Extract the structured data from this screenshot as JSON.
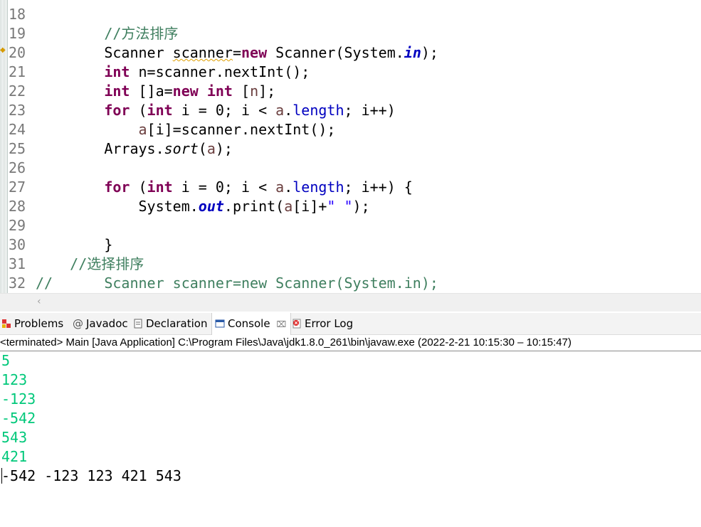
{
  "editor": {
    "lines": [
      {
        "n": "18",
        "tokens": []
      },
      {
        "n": "19",
        "tokens": [
          {
            "t": "        ",
            "c": ""
          },
          {
            "t": "//方法排序",
            "c": "cm"
          }
        ]
      },
      {
        "n": "20",
        "tokens": [
          {
            "t": "        Scanner ",
            "c": ""
          },
          {
            "t": "scanner",
            "c": "warn"
          },
          {
            "t": "=",
            "c": ""
          },
          {
            "t": "new",
            "c": "kw"
          },
          {
            "t": " Scanner(System.",
            "c": ""
          },
          {
            "t": "in",
            "c": "sfld"
          },
          {
            "t": ");",
            "c": ""
          }
        ]
      },
      {
        "n": "21",
        "tokens": [
          {
            "t": "        ",
            "c": ""
          },
          {
            "t": "int",
            "c": "kw"
          },
          {
            "t": " n=scanner.nextInt();",
            "c": ""
          }
        ]
      },
      {
        "n": "22",
        "tokens": [
          {
            "t": "        ",
            "c": ""
          },
          {
            "t": "int",
            "c": "kw"
          },
          {
            "t": " []a=",
            "c": ""
          },
          {
            "t": "new",
            "c": "kw"
          },
          {
            "t": " ",
            "c": ""
          },
          {
            "t": "int",
            "c": "kw"
          },
          {
            "t": " [",
            "c": ""
          },
          {
            "t": "n",
            "c": "var"
          },
          {
            "t": "];",
            "c": ""
          }
        ]
      },
      {
        "n": "23",
        "tokens": [
          {
            "t": "        ",
            "c": ""
          },
          {
            "t": "for",
            "c": "kw"
          },
          {
            "t": " (",
            "c": ""
          },
          {
            "t": "int",
            "c": "kw"
          },
          {
            "t": " i = 0; i < ",
            "c": ""
          },
          {
            "t": "a",
            "c": "var"
          },
          {
            "t": ".",
            "c": ""
          },
          {
            "t": "length",
            "c": "fld"
          },
          {
            "t": "; i++)",
            "c": ""
          }
        ]
      },
      {
        "n": "24",
        "tokens": [
          {
            "t": "            ",
            "c": ""
          },
          {
            "t": "a",
            "c": "var"
          },
          {
            "t": "[i]=scanner.nextInt();",
            "c": ""
          }
        ]
      },
      {
        "n": "25",
        "tokens": [
          {
            "t": "        Arrays.",
            "c": ""
          },
          {
            "t": "sort",
            "c": "sm"
          },
          {
            "t": "(",
            "c": ""
          },
          {
            "t": "a",
            "c": "var"
          },
          {
            "t": ");",
            "c": ""
          }
        ]
      },
      {
        "n": "26",
        "tokens": []
      },
      {
        "n": "27",
        "tokens": [
          {
            "t": "        ",
            "c": ""
          },
          {
            "t": "for",
            "c": "kw"
          },
          {
            "t": " (",
            "c": ""
          },
          {
            "t": "int",
            "c": "kw"
          },
          {
            "t": " i = 0; i < ",
            "c": ""
          },
          {
            "t": "a",
            "c": "var"
          },
          {
            "t": ".",
            "c": ""
          },
          {
            "t": "length",
            "c": "fld"
          },
          {
            "t": "; i++) {",
            "c": ""
          }
        ]
      },
      {
        "n": "28",
        "tokens": [
          {
            "t": "            System.",
            "c": ""
          },
          {
            "t": "out",
            "c": "sfld"
          },
          {
            "t": ".print(",
            "c": ""
          },
          {
            "t": "a",
            "c": "var"
          },
          {
            "t": "[i]+",
            "c": ""
          },
          {
            "t": "\" \"",
            "c": "st"
          },
          {
            "t": ");",
            "c": ""
          }
        ]
      },
      {
        "n": "29",
        "tokens": []
      },
      {
        "n": "30",
        "tokens": [
          {
            "t": "        }",
            "c": ""
          }
        ]
      },
      {
        "n": "31",
        "tokens": [
          {
            "t": "    ",
            "c": ""
          },
          {
            "t": "//选择排序",
            "c": "cm"
          }
        ]
      },
      {
        "n": "32",
        "tokens": [
          {
            "t": "//      Scanner scanner=new Scanner(System.in);",
            "c": "cm"
          }
        ]
      }
    ]
  },
  "tabs": {
    "problems": "Problems",
    "javadoc": "Javadoc",
    "declaration": "Declaration",
    "console": "Console",
    "console_close": "⌧",
    "errorlog": "Error Log"
  },
  "console": {
    "status": "<terminated> Main [Java Application] C:\\Program Files\\Java\\jdk1.8.0_261\\bin\\javaw.exe  (2022-2-21 10:15:30 – 10:15:47)",
    "input_lines": [
      "5",
      "123",
      "-123",
      "-542",
      "543",
      "421"
    ],
    "output_line": "-542 -123 123 421 543"
  },
  "colors": {
    "input": "#00c87a",
    "keyword": "#7f0055",
    "comment": "#3f7f5f",
    "string": "#2a00ff",
    "field": "#0000c0"
  }
}
